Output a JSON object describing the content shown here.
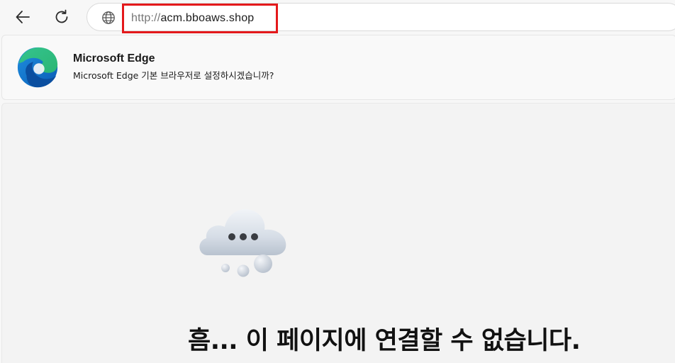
{
  "toolbar": {
    "back_icon": "arrow-left-icon",
    "refresh_icon": "refresh-icon",
    "site_info_icon": "globe-icon",
    "address": {
      "scheme": "http://",
      "host": "acm.bboaws.shop"
    },
    "highlight_color": "#e4191b"
  },
  "infobar": {
    "logo_icon": "microsoft-edge-logo",
    "title": "Microsoft Edge",
    "message": "Microsoft Edge 기본 브라우저로 설정하시겠습니까?"
  },
  "error_page": {
    "illustration": "cloud-with-dots-icon",
    "heading": "흠... 이 페이지에 연결할 수 없습니다."
  }
}
